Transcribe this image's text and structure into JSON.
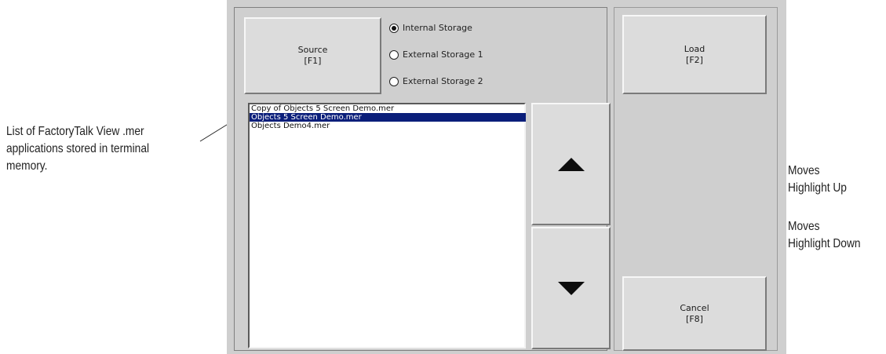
{
  "buttons": {
    "source": "Source\n[F1]",
    "load": "Load\n[F2]",
    "cancel": "Cancel\n[F8]"
  },
  "storage_options": [
    {
      "label": "Internal Storage",
      "selected": true
    },
    {
      "label": "External Storage 1",
      "selected": false
    },
    {
      "label": "External Storage 2",
      "selected": false
    }
  ],
  "applications": [
    {
      "name": "Copy of Objects 5 Screen Demo.mer",
      "selected": false
    },
    {
      "name": "Objects 5 Screen Demo.mer",
      "selected": true
    },
    {
      "name": "Objects Demo4.mer",
      "selected": false
    }
  ],
  "scroll": {
    "up_icon": "triangle-up-icon",
    "down_icon": "triangle-down-icon"
  },
  "annotations": {
    "list": [
      "List of FactoryTalk View .mer",
      "applications stored in terminal",
      "memory."
    ],
    "up": [
      "Moves",
      "Highlight Up"
    ],
    "down": [
      "Moves",
      "Highlight Down"
    ]
  },
  "colors": {
    "panel": "#cfcfcf",
    "selection": "#0a1e7a"
  }
}
